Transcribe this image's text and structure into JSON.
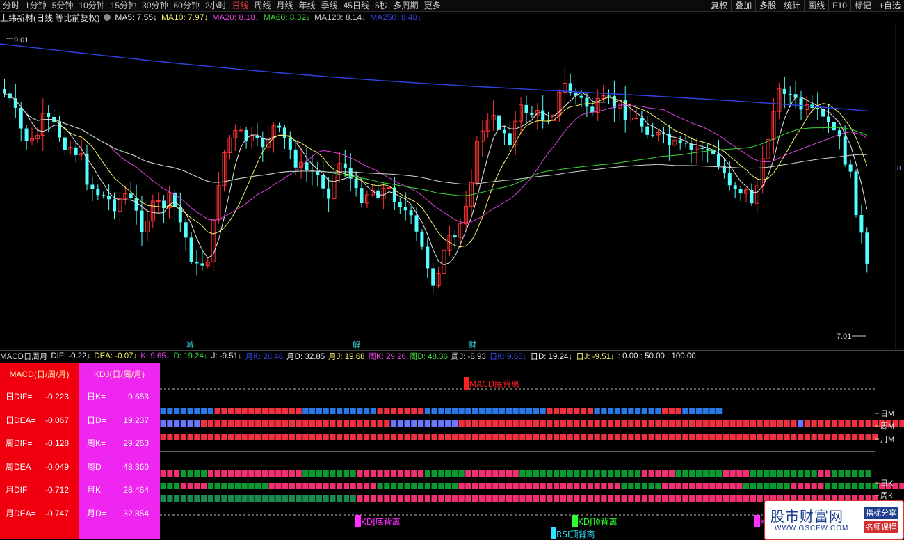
{
  "topbar": {
    "tabs": [
      "分时",
      "1分钟",
      "5分钟",
      "10分钟",
      "15分钟",
      "30分钟",
      "60分钟",
      "2小时",
      "日线",
      "周线",
      "月线",
      "年线",
      "季线",
      "45日线",
      "5秒",
      "多周期",
      "更多"
    ],
    "active_tab": "日线",
    "right_tools": [
      "复权",
      "叠加",
      "多股",
      "统计",
      "画线",
      "F10",
      "标记",
      "+自选"
    ]
  },
  "legend": {
    "stock": "上纬新材(日线 等比前复权)",
    "ma": [
      {
        "label": "MA5: 7.55↓",
        "color": "#e8e8e8"
      },
      {
        "label": "MA10: 7.97↓",
        "color": "#f3f36a"
      },
      {
        "label": "MA20: 8.18↓",
        "color": "#e040e0"
      },
      {
        "label": "MA60: 8.32↓",
        "color": "#38d838"
      },
      {
        "label": "MA120: 8.14↓",
        "color": "#d0d0d0"
      },
      {
        "label": "MA250: 8.48↓",
        "color": "#3044e6"
      }
    ]
  },
  "main_chart": {
    "high_label": "9.01",
    "low_label": "7.01",
    "right_price": "8.",
    "events": [
      "减",
      "解",
      "财"
    ],
    "colors": {
      "up": "#ff3232",
      "down": "#54ffff"
    }
  },
  "indicator_legend": [
    {
      "label": "MACD日周月",
      "color": "#d0d0d0"
    },
    {
      "label": "DIF: -0.22↓",
      "color": "#e8e8e8"
    },
    {
      "label": "DEA: -0.07↓",
      "color": "#f3f36a"
    },
    {
      "label": "K: 9.65↓",
      "color": "#e040e0"
    },
    {
      "label": "D: 19.24↓",
      "color": "#38d838"
    },
    {
      "label": "J: -9.51↓",
      "color": "#d0d0d0"
    },
    {
      "label": "月K: 28.46",
      "color": "#3044e6"
    },
    {
      "label": "月D: 32.85",
      "color": "#e8e8e8"
    },
    {
      "label": "月J: 19.68",
      "color": "#f3f36a"
    },
    {
      "label": "周K: 29.26",
      "color": "#e040e0"
    },
    {
      "label": "周D: 48.36",
      "color": "#38d838"
    },
    {
      "label": "周J: -8.93",
      "color": "#d0d0d0"
    },
    {
      "label": "日K: 9.65↓",
      "color": "#3044e6"
    },
    {
      "label": "日D: 19.24↓",
      "color": "#e8e8e8"
    },
    {
      "label": "日J: -9.51↓",
      "color": "#f3f36a"
    },
    {
      "label": ": 0.00 : 50.00 : 100.00",
      "color": "#e8e8e8"
    }
  ],
  "macd_panel": {
    "title": "MACD(日/周/月)",
    "rows": [
      {
        "k": "日DIF=",
        "v": "-0.223"
      },
      {
        "k": "日DEA=",
        "v": "-0.067"
      },
      {
        "k": "周DIF=",
        "v": "-0.128"
      },
      {
        "k": "周DEA=",
        "v": "-0.049"
      },
      {
        "k": "月DIF=",
        "v": "-0.712"
      },
      {
        "k": "月DEA=",
        "v": "-0.747"
      }
    ]
  },
  "kdj_panel": {
    "title": "KDJ(日/周/月)",
    "rows": [
      {
        "k": "日K=",
        "v": "9.653"
      },
      {
        "k": "日D=",
        "v": "19.237"
      },
      {
        "k": "周K=",
        "v": "29.263"
      },
      {
        "k": "周D=",
        "v": "48.360"
      },
      {
        "k": "月K=",
        "v": "28.464"
      },
      {
        "k": "月D=",
        "v": "32.854"
      }
    ]
  },
  "signals": {
    "macd_bottom": "MACD底背离",
    "kdj_bottom": "KDJ底背离",
    "kdj_top": "KDJ顶背离",
    "rsi_top": "RSI顶背离",
    "kdj_partial": "K"
  },
  "row_labels": {
    "macd": [
      "日M",
      "周M",
      "月M"
    ],
    "kdj": [
      "日K",
      "周K"
    ]
  },
  "watermark": {
    "title": "股市财富网",
    "url": "WWW.GSCFW.COM",
    "tag1": "指标分享",
    "tag2": "名师课程"
  }
}
